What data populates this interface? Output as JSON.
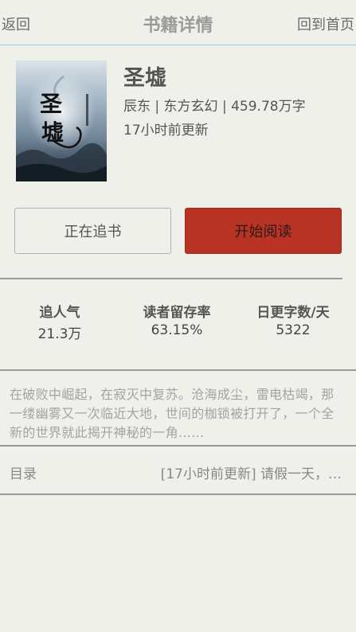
{
  "header": {
    "back_label": "返回",
    "title": "书籍详情",
    "home_label": "回到首页",
    "border_color": "#8fd3df"
  },
  "book": {
    "title": "圣墟",
    "author": "辰东",
    "category": "东方玄幻",
    "word_count": "459.78",
    "word_unit": "万字",
    "updated_num": "17",
    "updated_text": "小时前更新",
    "cover_icon": "book-cover-image"
  },
  "actions": {
    "follow_label": "正在追书",
    "read_label": "开始阅读",
    "read_color": "#b83324"
  },
  "stats": [
    {
      "label": "追人气",
      "value": "21.3",
      "unit": "万"
    },
    {
      "label": "读者留存率",
      "value": "63.15%",
      "unit": ""
    },
    {
      "label": "日更字数/天",
      "value": "5322",
      "unit": ""
    }
  ],
  "description": "在破败中崛起，在寂灭中复苏。沧海成尘，雷电枯竭，那一缕幽雾又一次临近大地，世间的枷锁被打开了，一个全新的世界就此揭开神秘的一角……",
  "toc": {
    "label": "目录",
    "latest_open": "[",
    "latest_num": "17",
    "latest_text": "小时前更新]",
    "latest_chapter": " 请假一天，…"
  }
}
